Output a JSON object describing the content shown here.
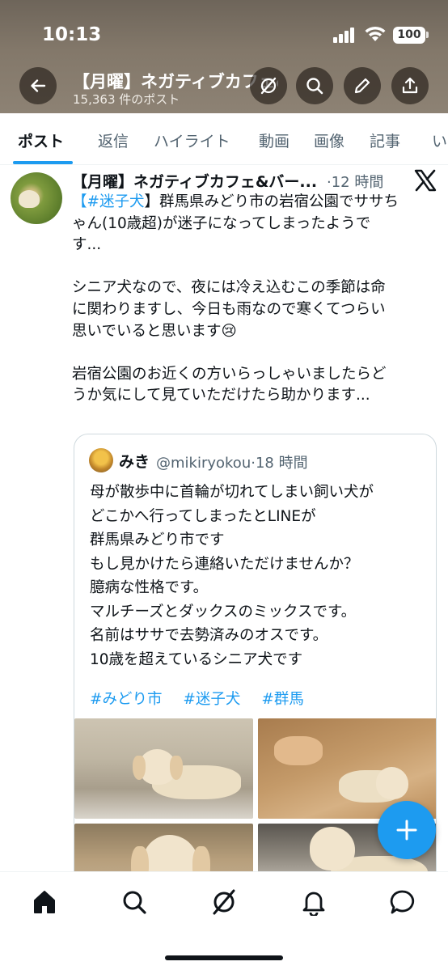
{
  "status_bar": {
    "time": "10:13",
    "battery": "100"
  },
  "header": {
    "title": "【月曜】ネガティブカフェ&バー...",
    "post_count": "15,363 件のポスト",
    "icons": {
      "back": "arrow-left-icon",
      "grok": "grok-icon",
      "search": "search-icon",
      "edit": "pencil-icon",
      "share": "share-icon"
    }
  },
  "tabs": [
    {
      "label": "ポスト",
      "active": true
    },
    {
      "label": "返信"
    },
    {
      "label": "ハイライト"
    },
    {
      "label": "動画"
    },
    {
      "label": "画像"
    },
    {
      "label": "記事"
    },
    {
      "label": "い"
    }
  ],
  "post": {
    "author": "【月曜】ネガティブカフェ&バー...",
    "separator": "·",
    "time": "12 時間",
    "hashtag": "【#迷子犬",
    "line1_rest": "】群馬県みどり市の岩宿公園でササち",
    "line2": "ゃん(10歳超)が迷子になってしまったようで",
    "line3": "す...",
    "para2_l1": "シニア犬なので、夜には冷え込むこの季節は命",
    "para2_l2": "に関わりますし、今日も雨なので寒くてつらい",
    "para2_l3": "思いでいると思います😢",
    "para3_l1": "岩宿公園のお近くの方いらっしゃいましたらど",
    "para3_l2": "うか気にして見ていただけたら助かります..."
  },
  "quote": {
    "name": "みき",
    "handle": "@mikiryokou",
    "separator": "·",
    "time": "18 時間",
    "lines": [
      "母が散歩中に首輪が切れてしまい飼い犬が",
      "どこかへ行ってしまったとLINEが",
      "群馬県みどり市です",
      "もし見かけたら連絡いただけませんか？",
      "臆病な性格です。",
      "マルチーズとダックスのミックスです。",
      "名前はササで去勢済みのオスです。",
      "10歳を超えているシニア犬です"
    ],
    "tags": [
      "#みどり市",
      "#迷子犬",
      "#群馬"
    ]
  },
  "fab": {
    "icon": "plus-icon"
  },
  "bottom_nav": [
    {
      "icon": "home-icon",
      "active": true
    },
    {
      "icon": "search-icon"
    },
    {
      "icon": "grok-icon"
    },
    {
      "icon": "bell-icon"
    },
    {
      "icon": "messages-icon"
    }
  ],
  "colors": {
    "accent": "#1d9bf0",
    "text": "#0f1419",
    "muted": "#536471"
  }
}
